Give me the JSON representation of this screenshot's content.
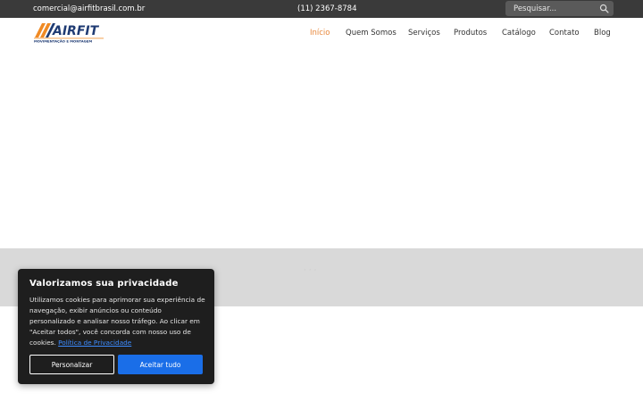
{
  "topbar": {
    "email": "comercial@airfitbrasil.com.br",
    "phone": "(11) 2367-8784",
    "search_placeholder": "Pesquisar..."
  },
  "logo": {
    "brand": "AIRFIT",
    "tagline": "MOVIMENTAÇÃO E MONTAGEM"
  },
  "nav": {
    "items": [
      {
        "label": "Início",
        "active": true
      },
      {
        "label": "Quem Somos"
      },
      {
        "label": "Serviços"
      },
      {
        "label": "Produtos"
      },
      {
        "label": "Catálogo"
      },
      {
        "label": "Contato"
      },
      {
        "label": "Blog"
      }
    ]
  },
  "band": {
    "text": "· · ·"
  },
  "cookie": {
    "title": "Valorizamos sua privacidade",
    "body": "Utilizamos cookies para aprimorar sua experiência de navegação, exibir anúncios ou conteúdo personalizado e analisar nosso tráfego. Ao clicar em \"Aceitar todos\", você concorda com nosso uso de cookies.",
    "policy_link": "Política de Privacidade",
    "customize_label": "Personalizar",
    "accept_label": "Aceitar tudo"
  },
  "colors": {
    "topbar": "#3a3a3a",
    "accent": "#e8873a",
    "logo_blue": "#1f3b73",
    "banner": "#d9d9d9",
    "cookie_bg": "#1e1e1e",
    "primary_button": "#1a6ee8"
  }
}
